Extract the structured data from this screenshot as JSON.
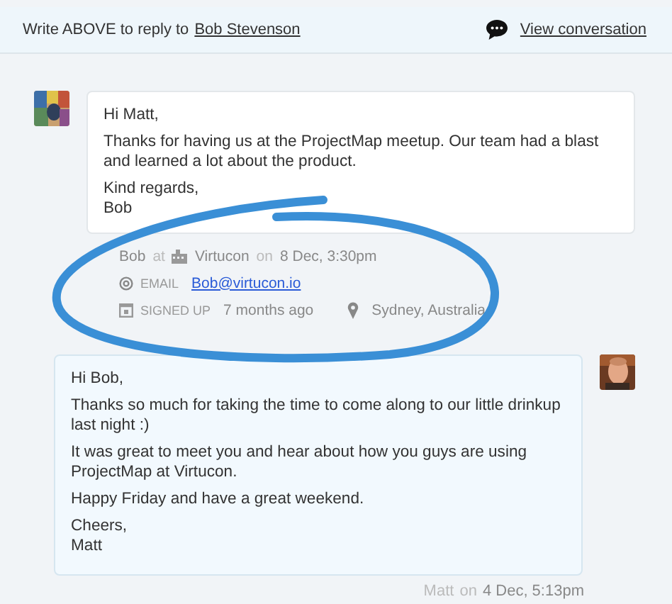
{
  "reply_bar": {
    "prompt": "Write ABOVE to reply to",
    "recipient": "Bob Stevenson",
    "view_link": "View conversation"
  },
  "messages": [
    {
      "kind": "incoming",
      "paragraphs": [
        "Hi Matt,",
        "Thanks for having us at the ProjectMap meetup. Our team had a blast and learned a lot about the product.",
        "Kind regards,\nBob"
      ],
      "meta": {
        "author": "Bob",
        "at": "at",
        "company": "Virtucon",
        "on": "on",
        "time": "8 Dec, 3:30pm",
        "email_label": "EMAIL",
        "email": "Bob@virtucon.io",
        "signed_up_label": "SIGNED UP",
        "signed_up": "7 months ago",
        "location": "Sydney, Australia"
      }
    },
    {
      "kind": "outgoing",
      "paragraphs": [
        "Hi Bob,",
        "Thanks so much for taking the time to come along to our little drinkup last night :)",
        "It was great to meet you and hear about how you guys are using ProjectMap at Virtucon.",
        "Happy Friday and have a great weekend.",
        "Cheers,\nMatt"
      ],
      "meta": {
        "author": "Matt",
        "on": "on",
        "time": "4 Dec, 5:13pm"
      }
    }
  ]
}
